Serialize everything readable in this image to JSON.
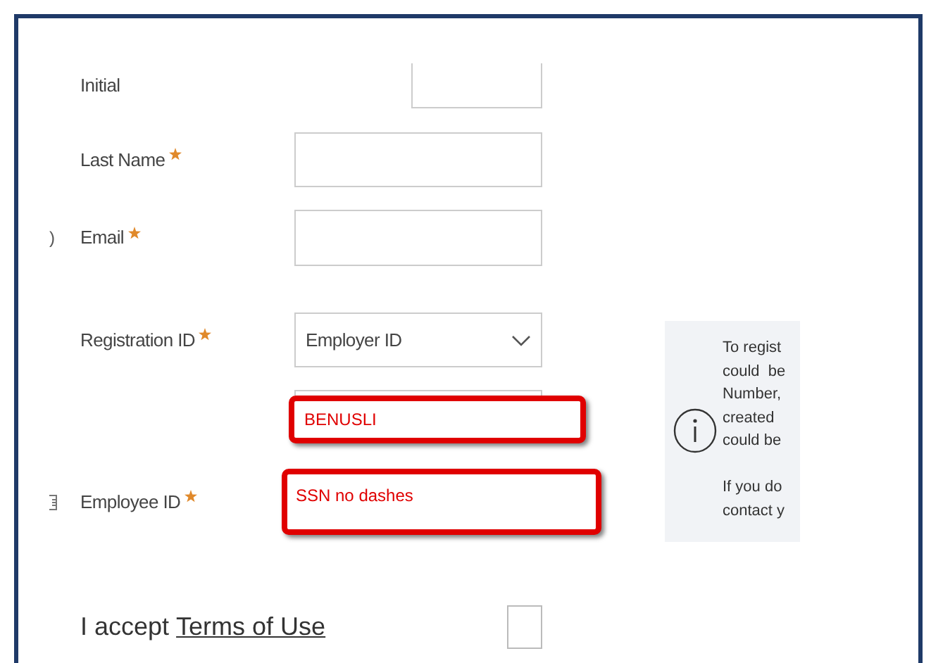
{
  "form": {
    "fields": [
      {
        "kind": "short",
        "label": "Initial",
        "required": false
      },
      {
        "kind": "text",
        "label": "Last Name",
        "required": true
      },
      {
        "kind": "text",
        "label": "Email",
        "required": true,
        "edge_text": ")"
      },
      {
        "kind": "select",
        "label": "Registration ID",
        "required": true,
        "value": "Employer ID"
      },
      {
        "kind": "highlighted",
        "value": "BENUSLI"
      },
      {
        "kind": "highlighted",
        "label": "Employee ID",
        "required": true,
        "value": "SSN no dashes",
        "edge_icon": true
      }
    ]
  },
  "info_panel": {
    "paragraphs": [
      [
        "To regist",
        "could  be",
        "Number,",
        "created",
        "could be"
      ],
      [
        "If you do",
        "contact y"
      ]
    ]
  },
  "terms": {
    "prefix": "I accept",
    "link": "Terms of Use",
    "checked": false
  }
}
